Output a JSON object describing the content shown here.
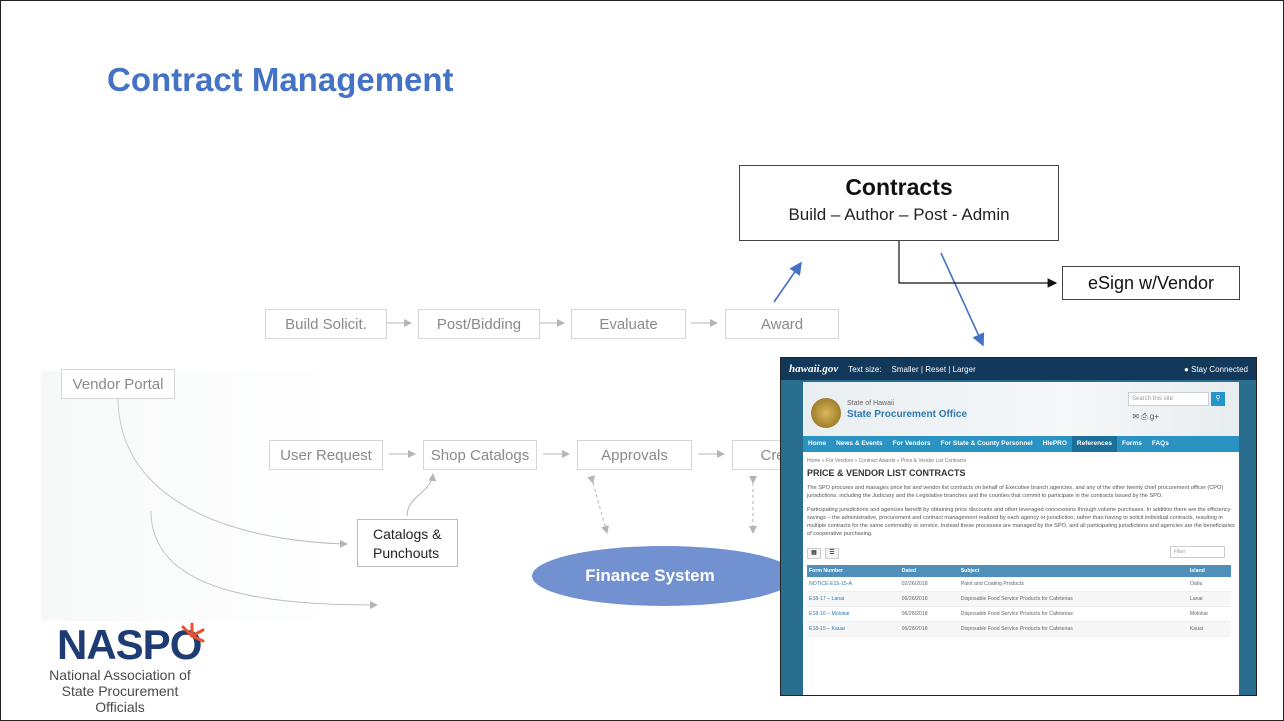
{
  "slide": {
    "title": "Contract Management"
  },
  "contracts": {
    "title": "Contracts",
    "subtitle": "Build – Author – Post - Admin"
  },
  "esign": {
    "label": "eSign w/Vendor"
  },
  "flow_top": [
    "Build Solicit.",
    "Post/Bidding",
    "Evaluate",
    "Award"
  ],
  "flow_mid": [
    "User Request",
    "Shop Catalogs",
    "Approvals",
    "Crea"
  ],
  "vendor_portal": "Vendor Portal",
  "catalogs": {
    "line1": "Catalogs &",
    "line2": "Punchouts"
  },
  "finance_system": "Finance System",
  "logo": {
    "word": "NASPO",
    "line1": "National Association of",
    "line2": "State Procurement Officials"
  },
  "screenshot": {
    "brand": "hawaii.gov",
    "text_size": "Text size:",
    "size_options": "Smaller | Reset | Larger",
    "stay_connected": "Stay Connected",
    "state": "State of Hawaii",
    "office": "State Procurement Office",
    "search_placeholder": "Search this site",
    "nav": [
      "Home",
      "News & Events",
      "For Vendors",
      "For State & County Personnel",
      "HIePRO",
      "References",
      "Forms",
      "FAQs"
    ],
    "breadcrumb": "Home » For Vendors » Contract Awards » Price & Vendor List Contracts",
    "heading": "PRICE & VENDOR LIST CONTRACTS",
    "para1": "The SPO procures and manages price list and vendor list contracts on behalf of Executive branch agencies, and any of the other twenty chief procurement officer (CPO) jurisdictions, including the Judiciary and the Legislative branches and the counties that commit to participate in the contracts issued by the SPO.",
    "para2": "Participating jurisdictions and agencies benefit by obtaining price discounts and other leveraged concessions through volume purchases. In addition there are the efficiency savings – the administrative, procurement and contract management realized by each agency or jurisdiction, rather than having to solicit individual contracts, resulting in multiple contracts for the same commodity or service. Instead these processes are managed by the SPO, and all participating jurisdictions and agencies are the beneficiaries of cooperative purchasing.",
    "filter_placeholder": "Filter",
    "columns": [
      "Form Number",
      "Dated",
      "Subject",
      "Island"
    ],
    "rows": [
      [
        "NOTICE E15-15-A",
        "02/26/2018",
        "Paint and Coating Products",
        "Oahu"
      ],
      [
        "E18-17 – Lanai",
        "06/26/2018",
        "Disposable Food Service Products for Cafeterias",
        "Lanai"
      ],
      [
        "E18-16 – Molokai",
        "06/26/2018",
        "Disposable Food Service Products for Cafeterias",
        "Molokai"
      ],
      [
        "E18-15 – Kauai",
        "06/26/2018",
        "Disposable Food Service Products for Cafeterias",
        "Kauai"
      ]
    ]
  },
  "colors": {
    "title_blue": "#4472c4",
    "ellipse_blue": "#7191d1",
    "nav_blue": "#2b93c4",
    "arrow_blue": "#4472c4"
  }
}
